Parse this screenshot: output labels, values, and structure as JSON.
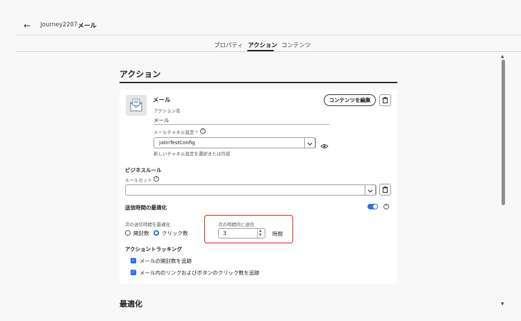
{
  "breadcrumb": {
    "parent": "Journey2207",
    "separator": "›",
    "current": "メール"
  },
  "tabs": [
    {
      "label": "プロパティ"
    },
    {
      "label": "アクション"
    },
    {
      "label": "コンテンツ"
    }
  ],
  "section": {
    "title": "アクション"
  },
  "action": {
    "name": "メール",
    "edit_content_label": "コンテンツを編集",
    "action_name_label": "アクション名",
    "action_name_value": "メール",
    "channel_label": "メールチャネル設定 *",
    "channel_value": "jatinTestConfig",
    "channel_hint": "新しいチャネル設定を選択または作成"
  },
  "business_rules": {
    "heading": "ビジネスルール",
    "ruleset_label": "ルールセット",
    "ruleset_value": ""
  },
  "send_time": {
    "heading": "送信時間の最適化",
    "enabled": true,
    "optimize_label": "次の送信時間を最適化",
    "options": [
      "開封数",
      "クリック数"
    ],
    "selected": "クリック数",
    "within_label": "次の時間内に送信",
    "within_value": "3",
    "unit": "時間"
  },
  "tracking": {
    "heading": "アクショントラッキング",
    "items": [
      {
        "label": "メールの開封数を追跡",
        "checked": true
      },
      {
        "label": "メール内のリンクおよびボタンのクリック数を追跡",
        "checked": true
      }
    ]
  },
  "next_section": {
    "title": "最適化"
  },
  "colors": {
    "accent": "#2d6ee6",
    "highlight": "#d0262c"
  }
}
